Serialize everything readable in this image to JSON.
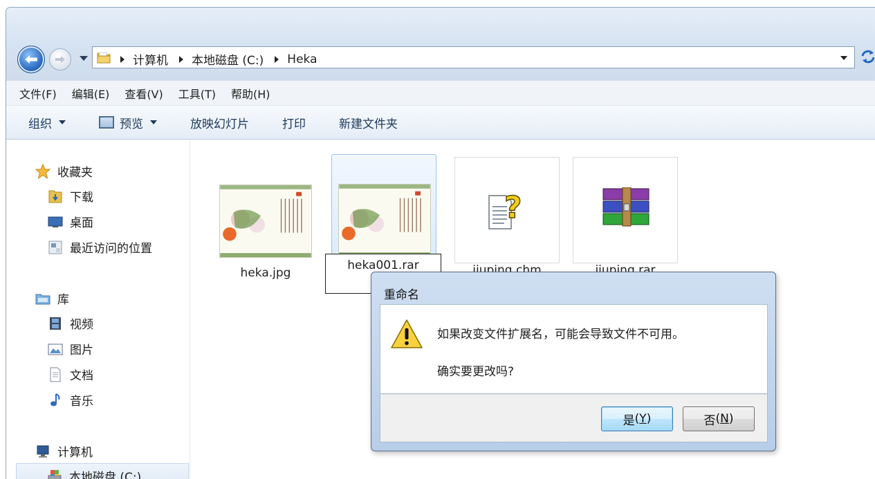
{
  "address": {
    "crumbs": [
      "计算机",
      "本地磁盘 (C:)",
      "Heka"
    ]
  },
  "menu": {
    "items": [
      "文件(F)",
      "编辑(E)",
      "查看(V)",
      "工具(T)",
      "帮助(H)"
    ]
  },
  "toolbar": {
    "organize": "组织",
    "preview": "预览",
    "slideshow": "放映幻灯片",
    "print": "打印",
    "new_folder": "新建文件夹"
  },
  "sidebar": {
    "favorites": "收藏夹",
    "downloads": "下载",
    "desktop": "桌面",
    "recent": "最近访问的位置",
    "libraries": "库",
    "videos": "视频",
    "pictures": "图片",
    "documents": "文档",
    "music": "音乐",
    "computer": "计算机",
    "local_disk": "本地磁盘 (C:)"
  },
  "files": [
    {
      "name": "heka.jpg",
      "type": "image"
    },
    {
      "name": "heka001.rar",
      "type": "image",
      "state": "renaming"
    },
    {
      "name": "jiuping.chm",
      "type": "help"
    },
    {
      "name": "jiuping.rar",
      "type": "archive"
    }
  ],
  "dialog": {
    "title": "重命名",
    "message": "如果改变文件扩展名，可能会导致文件不可用。",
    "question": "确实要更改吗?",
    "yes_label": "是",
    "yes_key": "Y",
    "no_label": "否",
    "no_key": "N"
  }
}
